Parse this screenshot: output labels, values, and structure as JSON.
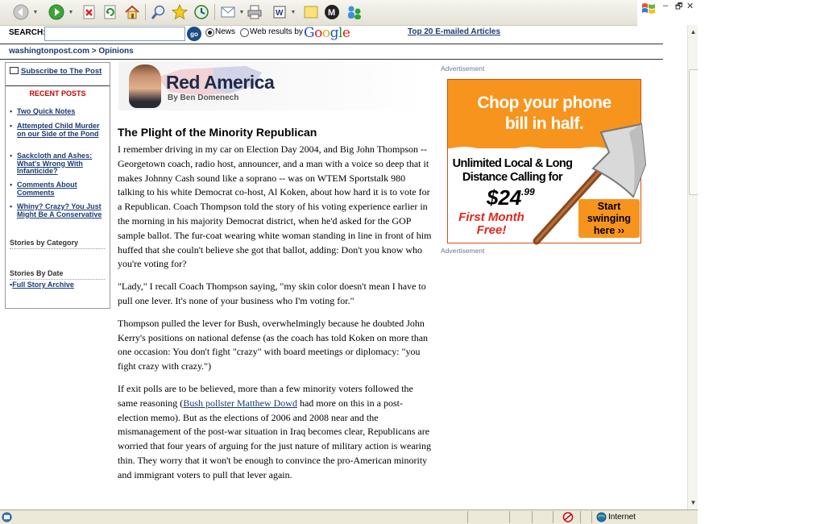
{
  "browser": {
    "toolbar_icons": [
      "back-icon",
      "forward-icon",
      "stop-icon",
      "refresh-icon",
      "home-icon",
      "search-icon",
      "favorites-icon",
      "history-icon",
      "mail-icon",
      "print-icon",
      "edit-icon",
      "discuss-icon",
      "messenger-icon",
      "research-icon"
    ],
    "window_controls": {
      "minimize": "–",
      "restore": "🗗",
      "close": "✕"
    },
    "status": {
      "zone": "Internet"
    }
  },
  "search": {
    "label": "SEARCH:",
    "value": "",
    "go_label": "go",
    "options": [
      "News",
      "Web results by"
    ],
    "provider": [
      "G",
      "o",
      "o",
      "g",
      "l",
      "e"
    ],
    "provider_colors": [
      "#1f4fc9",
      "#d21f1f",
      "#e6a813",
      "#1f4fc9",
      "#1f9b36",
      "#d21f1f"
    ],
    "top_link": "Top 20 E-mailed Articles"
  },
  "breadcrumb": "washingtonpost.com > Opinions",
  "sidebar": {
    "subscribe": "Subscribe to The Post",
    "recent_heading": "RECENT POSTS",
    "recent_posts": [
      "Two Quick Notes",
      "Attempted Child Murder on our Side of the Pond",
      "Sackcloth and Ashes: What's Wrong With Infanticide?",
      "Comments About Comments",
      "Whiny? Crazy? You Just Might Be A Conservative"
    ],
    "stories_by_category": "Stories by Category",
    "stories_by_date": "Stories By Date",
    "archive_link": "Full Story Archive"
  },
  "banner": {
    "title": "Red America",
    "byline": "By Ben Domenech"
  },
  "article": {
    "headline": "The Plight of the Minority Republican",
    "p1": "I remember driving in my car on Election Day 2004, and Big John Thompson -- Georgetown coach, radio host, announcer, and a man with a voice so deep that it makes Johnny Cash sound like a soprano -- was on WTEM Sportstalk 980 talking to his white Democrat co-host, Al Koken, about how hard it is to vote for a Republican. Coach Thompson told the story of his voting experience earlier in the morning in his majority Democrat district, when he'd asked for the GOP sample ballot. The fur-coat wearing white woman standing in line in front of him huffed that she couln't believe she got that ballot, adding: Don't you know who you're voting for?",
    "p2": "\"Lady,\" I recall Coach Thompson saying, \"my skin color doesn't mean I have to pull one lever. It's none of your business who I'm voting for.\"",
    "p3": "Thompson pulled the lever for Bush, overwhelmingly because he doubted John Kerry's positions on national defense (as the coach has told Koken on more than one occasion: You don't fight \"crazy\" with board meetings or diplomacy: \"you fight crazy with crazy.\")",
    "p4_before": "If exit polls are to be believed, more than a few minority voters followed the same reasoning (",
    "p4_link": "Bush pollster Matthew Dowd",
    "p4_after": " had more on this in a post-election memo). But as the elections of 2006 and 2008 near and the mismanagement of the post-war situation in Iraq becomes clear, Republicans are worried that four years of arguing for the just nature of military action is wearing thin. They worry that it won't be enough to convince the pro-American minority and immigrant voters to pull that lever again."
  },
  "ad": {
    "label_top": "Advertisement",
    "label_bottom": "Advertisement",
    "headline_1": "Chop your phone",
    "headline_2": "bill in half.",
    "line_1": "Unlimited Local & Long",
    "line_2": "Distance Calling for",
    "price_dollar": "$24",
    "price_cents": ".99",
    "free_1": "First Month",
    "free_2": "Free!",
    "cta_1": "Start",
    "cta_2": "swinging",
    "cta_3": "here ››",
    "accent": "#f7941d"
  }
}
